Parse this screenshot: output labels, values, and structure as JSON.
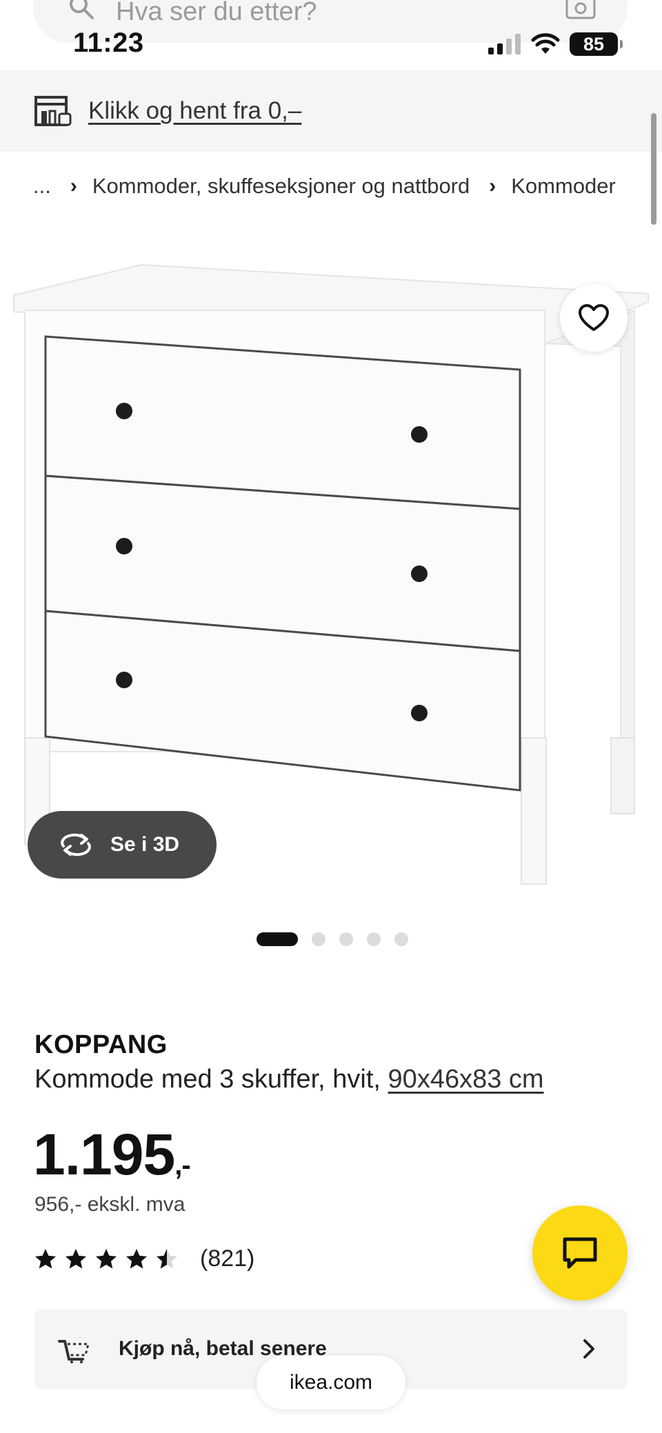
{
  "status_bar": {
    "time": "11:23",
    "battery": "85"
  },
  "search": {
    "placeholder": "Hva ser du etter?"
  },
  "promo": {
    "label": "Klikk og hent fra 0,–"
  },
  "breadcrumb": {
    "ellipsis": "...",
    "items": [
      "Kommoder, skuffeseksjoner og nattbord",
      "Kommoder"
    ]
  },
  "gallery": {
    "see_3d_label": "Se i 3D",
    "image_count": 5,
    "active_index": 0
  },
  "product": {
    "brand": "KOPPANG",
    "description": "Kommode med 3 skuffer, hvit, ",
    "dimensions": "90x46x83 cm",
    "price_main": "1.195",
    "price_suffix": ",-",
    "price_ex_vat": "956,- ekskl. mva",
    "rating": 4.5,
    "rating_max": 5,
    "review_count": "(821)"
  },
  "bnpl": {
    "label": "Kjøp nå, betal senere"
  },
  "browser": {
    "url": "ikea.com"
  },
  "icons": [
    "search-icon",
    "camera-icon",
    "signal-icon",
    "wifi-icon",
    "battery-icon",
    "store-pickup-icon",
    "heart-icon",
    "rotate-3d-icon",
    "star-icon",
    "chat-icon",
    "shopping-bag-icon",
    "chevron-right-icon"
  ],
  "colors": {
    "accent_yellow": "#fbd914",
    "button_dark": "#484848",
    "banner_gray": "#f5f5f5"
  }
}
